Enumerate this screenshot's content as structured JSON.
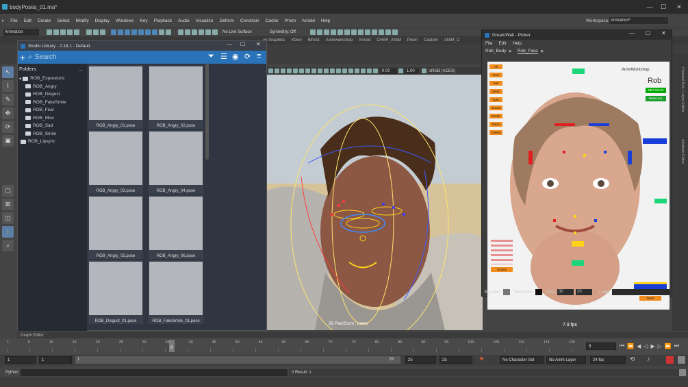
{
  "window": {
    "title": "bodyPoses_01.ma*",
    "min": "—",
    "max": "☐",
    "close": "✕"
  },
  "menu": [
    "File",
    "Edit",
    "Create",
    "Select",
    "Modify",
    "Display",
    "Windows",
    "Key",
    "Playback",
    "Audio",
    "Visualize",
    "Deform",
    "Constrain",
    "Cache",
    "Prism",
    "Arnold",
    "Help"
  ],
  "workspace": {
    "label": "Workspace:",
    "value": "Animation*"
  },
  "status": {
    "mode": "Animation",
    "live_surface": "No Live Surface",
    "symmetry": "Symmetry: Off"
  },
  "shelf_tabs": [
    "on Graphics",
    "XGen",
    "Bifrost",
    "Animworkshop",
    "Arnold",
    "CHAR_ANIM",
    "Prism",
    "Custom",
    "ANIM_C"
  ],
  "studio": {
    "title": "Studio Library - 2.18.1 - Default",
    "search_placeholder": "Search",
    "folders_label": "Folders",
    "folders_menu": "...",
    "root": "ROB_Expresions",
    "folders": [
      "ROB_Angry",
      "ROB_Disgust",
      "ROB_FakeSmile",
      "ROB_Fear",
      "ROB_Misc",
      "ROB_Sad",
      "ROB_Smile"
    ],
    "lipsync": "ROB_Lipsync",
    "poses": [
      "ROB_Angry_01.pose",
      "ROB_Angry_02.pose",
      "ROB_Angry_03.pose",
      "ROB_Angry_04.pose",
      "ROB_Angry_05.pose",
      "ROB_Angry_06.pose",
      "ROB_Disgust_01.pose",
      "ROB_FakeSmile_01.pose"
    ]
  },
  "viewport": {
    "exposure": "0.00",
    "gamma": "1.00",
    "colorspace": "sRGB (ACES)",
    "camera": "2D Pan/Zoom : persp",
    "fps": "7.9 fps"
  },
  "picker": {
    "title": "DreamWall - Picker",
    "menu": [
      "File",
      "Edit",
      "Help"
    ],
    "tabs": [
      "Rob_Body",
      "Rob_Face"
    ],
    "brand": "AnimWorkshop",
    "char": "Rob",
    "set_char": "SET CHAR",
    "reset_all": "Reset ALL",
    "buttons": [
      "All",
      "Face",
      "Hair",
      "Mask",
      "Eyes",
      "Brows",
      "Mouth",
      "Micro",
      "Cheeks"
    ],
    "tongue": "Tongue",
    "teeth": "Teeth",
    "bg_color_label": "Bg-color:",
    "text_color_label": "Text-color:",
    "size_label": "Size:",
    "size_w": "30",
    "size_h": "20",
    "label_label": "Label:"
  },
  "dock_labels": [
    "Channel Box / Layer Editor",
    "Attribute Editor"
  ],
  "bottom": {
    "graph_editor": "Graph Editor",
    "ticks": [
      "1",
      "5",
      "10",
      "15",
      "20",
      "25",
      "30",
      "35",
      "40",
      "45",
      "50",
      "55",
      "60",
      "65",
      "70",
      "75",
      "80",
      "85",
      "90",
      "95",
      "100",
      "105",
      "110",
      "115",
      "120"
    ],
    "current_frame_marker": "8",
    "current_frame": "8",
    "start": "1",
    "start2": "1",
    "range_start": "1",
    "range_end": "25",
    "end": "25",
    "end2": "25",
    "char_set": "No Character Set",
    "anim_layer": "No Anim Layer",
    "fps": "24 fps",
    "cmd_lang": "Python",
    "result": "// Result: 1"
  },
  "colors": {
    "accent": "#2a73b8",
    "picker_orange": "#f28c1c",
    "ctl_red": "#e02020",
    "ctl_blue": "#1a3fd8",
    "ctl_yellow": "#ffd21a",
    "ctl_green": "#1ed67a"
  }
}
